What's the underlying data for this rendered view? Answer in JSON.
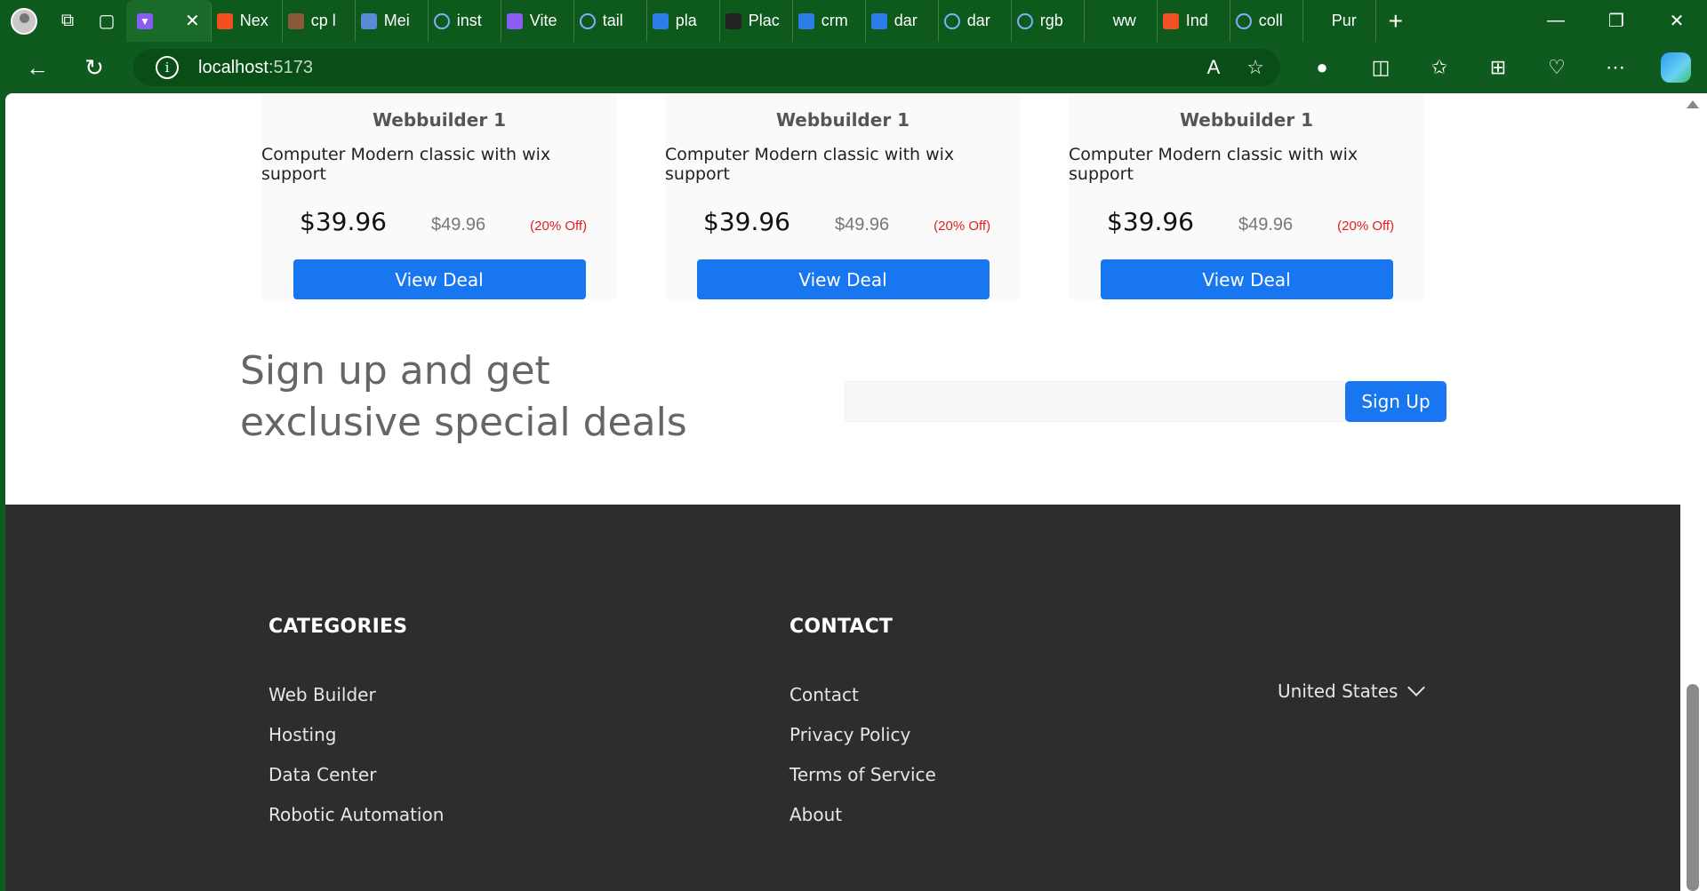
{
  "browser": {
    "tabs": [
      {
        "label": "Nex",
        "icon": "figma-icon",
        "color": "#f24e1e"
      },
      {
        "label": "cp l",
        "icon": "pdf-icon",
        "color": "#8b5a3c"
      },
      {
        "label": "Mei",
        "icon": "diamond-icon",
        "color": "#5a8bd6"
      },
      {
        "label": "inst",
        "icon": "search-icon",
        "color": "#0e5a1d"
      },
      {
        "label": "Vite",
        "icon": "vite-icon",
        "color": "#8a5cf5"
      },
      {
        "label": "tail",
        "icon": "search-icon",
        "color": "#0e5a1d"
      },
      {
        "label": "pla",
        "icon": "bing-icon",
        "color": "#2b7de9"
      },
      {
        "label": "Plac",
        "icon": "dark-square-icon",
        "color": "#222222"
      },
      {
        "label": "crm",
        "icon": "bing-icon",
        "color": "#2b7de9"
      },
      {
        "label": "dar",
        "icon": "bing-icon",
        "color": "#2b7de9"
      },
      {
        "label": "dar",
        "icon": "search-icon",
        "color": "#0e5a1d"
      },
      {
        "label": "rgb",
        "icon": "search-icon",
        "color": "#0e5a1d"
      },
      {
        "label": "ww",
        "icon": "page-icon",
        "color": "#0e5a1d"
      },
      {
        "label": "Ind",
        "icon": "microsoft-icon",
        "color": "#f25022"
      },
      {
        "label": "coll",
        "icon": "search-icon",
        "color": "#0e5a1d"
      },
      {
        "label": "Pur",
        "icon": "openai-icon",
        "color": "#0e5a1d"
      }
    ],
    "url_host": "localhost",
    "url_port": ":5173"
  },
  "products": [
    {
      "title": "Webbuilder 1",
      "desc": "Computer Modern classic with wix support",
      "price": "$39.96",
      "old_price": "$49.96",
      "discount": "(20% Off)",
      "cta": "View Deal"
    },
    {
      "title": "Webbuilder 1",
      "desc": "Computer Modern classic with wix support",
      "price": "$39.96",
      "old_price": "$49.96",
      "discount": "(20% Off)",
      "cta": "View Deal"
    },
    {
      "title": "Webbuilder 1",
      "desc": "Computer Modern classic with wix support",
      "price": "$39.96",
      "old_price": "$49.96",
      "discount": "(20% Off)",
      "cta": "View Deal"
    }
  ],
  "signup": {
    "heading": "Sign up and get exclusive special deals",
    "placeholder": "",
    "button": "Sign Up"
  },
  "footer": {
    "categories": {
      "heading": "CATEGORIES",
      "items": [
        "Web Builder",
        "Hosting",
        "Data Center",
        "Robotic Automation"
      ]
    },
    "contact": {
      "heading": "CONTACT",
      "items": [
        "Contact",
        "Privacy Policy",
        "Terms of Service",
        "About"
      ]
    },
    "country": "United States"
  },
  "colors": {
    "accent": "#1776f0",
    "footer_bg": "#2b2d2f",
    "browser_chrome": "#0e5a1d",
    "discount": "#e02020"
  }
}
